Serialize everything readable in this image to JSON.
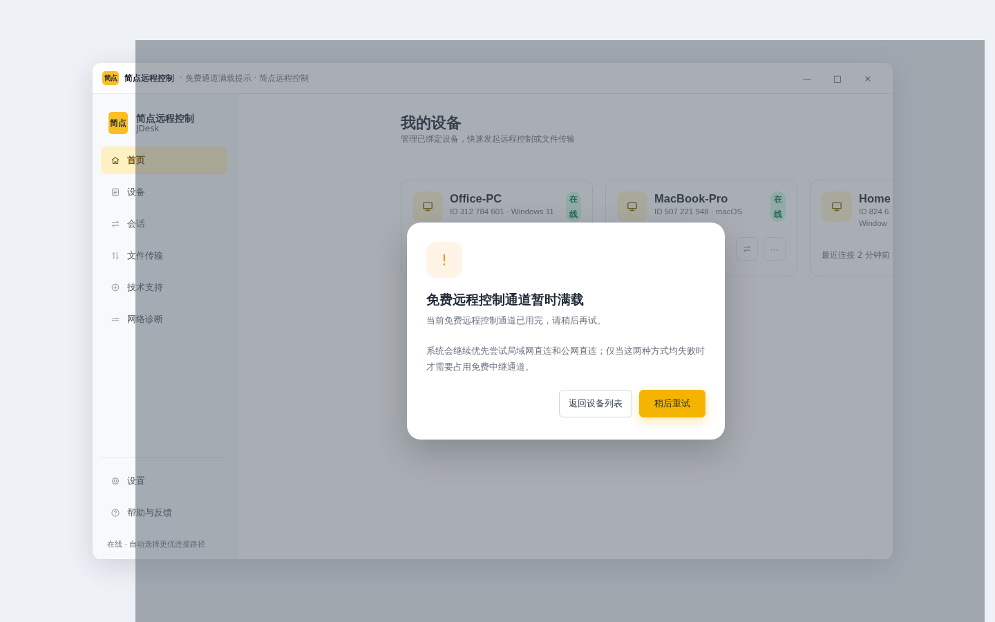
{
  "window": {
    "logo": "简点",
    "app_name": "简点远程控制",
    "title_rest": "· 免费通道满载提示 · 简点远程控制",
    "controls": [
      "—",
      "□",
      "×"
    ]
  },
  "sidebar": {
    "logo": "简点",
    "app_name": "简点远程控制",
    "app_subtitle": "JDesk",
    "items": [
      {
        "label": "首页",
        "selected": true
      },
      {
        "label": "设备",
        "selected": false
      },
      {
        "label": "会话",
        "selected": false
      },
      {
        "label": "文件传输",
        "selected": false
      },
      {
        "label": "技术支持",
        "selected": false
      },
      {
        "label": "网络诊断",
        "selected": false
      }
    ],
    "bottom_items": [
      {
        "label": "设置"
      },
      {
        "label": "帮助与反馈"
      }
    ],
    "status": "在线 · 自动选择更优连接路径"
  },
  "main": {
    "title": "我的设备",
    "subtitle": "管理已绑定设备，快速发起远程控制或文件传输",
    "devices": [
      {
        "name": "Office-PC",
        "meta": [
          "ID 312 784 601 · Windows 11"
        ],
        "status": "在线"
      },
      {
        "name": "MacBook-Pro",
        "meta": [
          "ID 507 221 948 · macOS"
        ],
        "status": "在线",
        "actions": [
          {
            "kind": "swap"
          },
          {
            "kind": "more",
            "label": "···"
          }
        ]
      },
      {
        "name": "Home",
        "meta": [
          "ID 824 6",
          "Window"
        ],
        "footer": "最近连接 2 分钟前"
      }
    ]
  },
  "dialog": {
    "icon": "!",
    "title": "免费远程控制通道暂时满载",
    "message": "当前免费远程控制通道已用完，请稍后再试。",
    "detail": "系统会继续优先尝试局域网直连和公网直连；仅当这两种方式均失败时才需要占用免费中继通道。",
    "buttons": [
      {
        "label": "返回设备列表",
        "kind": "secondary"
      },
      {
        "label": "稍后重试",
        "kind": "primary"
      }
    ]
  }
}
